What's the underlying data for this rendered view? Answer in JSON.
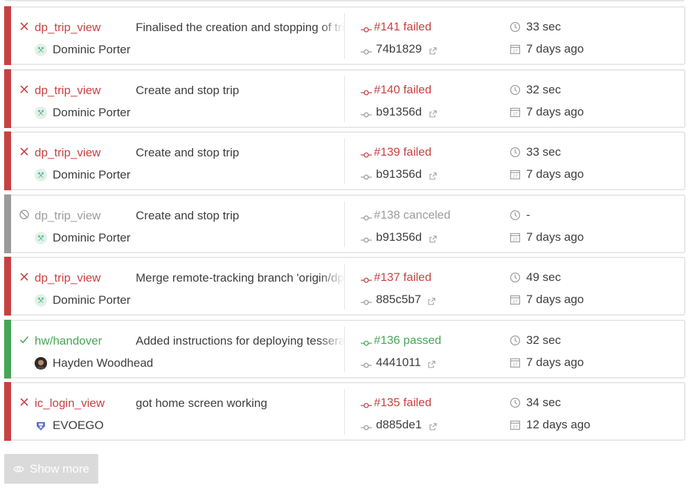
{
  "builds": [
    {
      "status": "failed",
      "status_icon": "x-icon",
      "branch": "dp_trip_view",
      "message": "Finalised the creation and stopping of trips",
      "author": "Dominic Porter",
      "avatar": "identicon-green",
      "build_number": "#141 failed",
      "commit": "74b1829",
      "duration": "33 sec",
      "finished": "7 days ago"
    },
    {
      "status": "failed",
      "status_icon": "x-icon",
      "branch": "dp_trip_view",
      "message": "Create and stop trip",
      "author": "Dominic Porter",
      "avatar": "identicon-green",
      "build_number": "#140 failed",
      "commit": "b91356d",
      "duration": "32 sec",
      "finished": "7 days ago"
    },
    {
      "status": "failed",
      "status_icon": "x-icon",
      "branch": "dp_trip_view",
      "message": "Create and stop trip",
      "author": "Dominic Porter",
      "avatar": "identicon-green",
      "build_number": "#139 failed",
      "commit": "b91356d",
      "duration": "33 sec",
      "finished": "7 days ago"
    },
    {
      "status": "canceled",
      "status_icon": "canceled-icon",
      "branch": "dp_trip_view",
      "message": "Create and stop trip",
      "author": "Dominic Porter",
      "avatar": "identicon-green",
      "build_number": "#138 canceled",
      "commit": "b91356d",
      "duration": "-",
      "finished": "7 days ago"
    },
    {
      "status": "failed",
      "status_icon": "x-icon",
      "branch": "dp_trip_view",
      "message": "Merge remote-tracking branch 'origin/dp_trip_view'",
      "author": "Dominic Porter",
      "avatar": "identicon-green",
      "build_number": "#137 failed",
      "commit": "885c5b7",
      "duration": "49 sec",
      "finished": "7 days ago"
    },
    {
      "status": "passed",
      "status_icon": "check-icon",
      "branch": "hw/handover",
      "message": "Added instructions for deploying tesseract",
      "author": "Hayden Woodhead",
      "avatar": "photo",
      "build_number": "#136 passed",
      "commit": "4441011",
      "duration": "32 sec",
      "finished": "7 days ago"
    },
    {
      "status": "failed",
      "status_icon": "x-icon",
      "branch": "ic_login_view",
      "message": "got home screen working",
      "author": "EVOEGO",
      "avatar": "identicon-blue",
      "build_number": "#135 failed",
      "commit": "d885de1",
      "duration": "34 sec",
      "finished": "12 days ago"
    }
  ],
  "show_more_label": "Show more",
  "colors": {
    "failed": "#c84142",
    "passed": "#47a655",
    "canceled": "#9b9b9b"
  }
}
